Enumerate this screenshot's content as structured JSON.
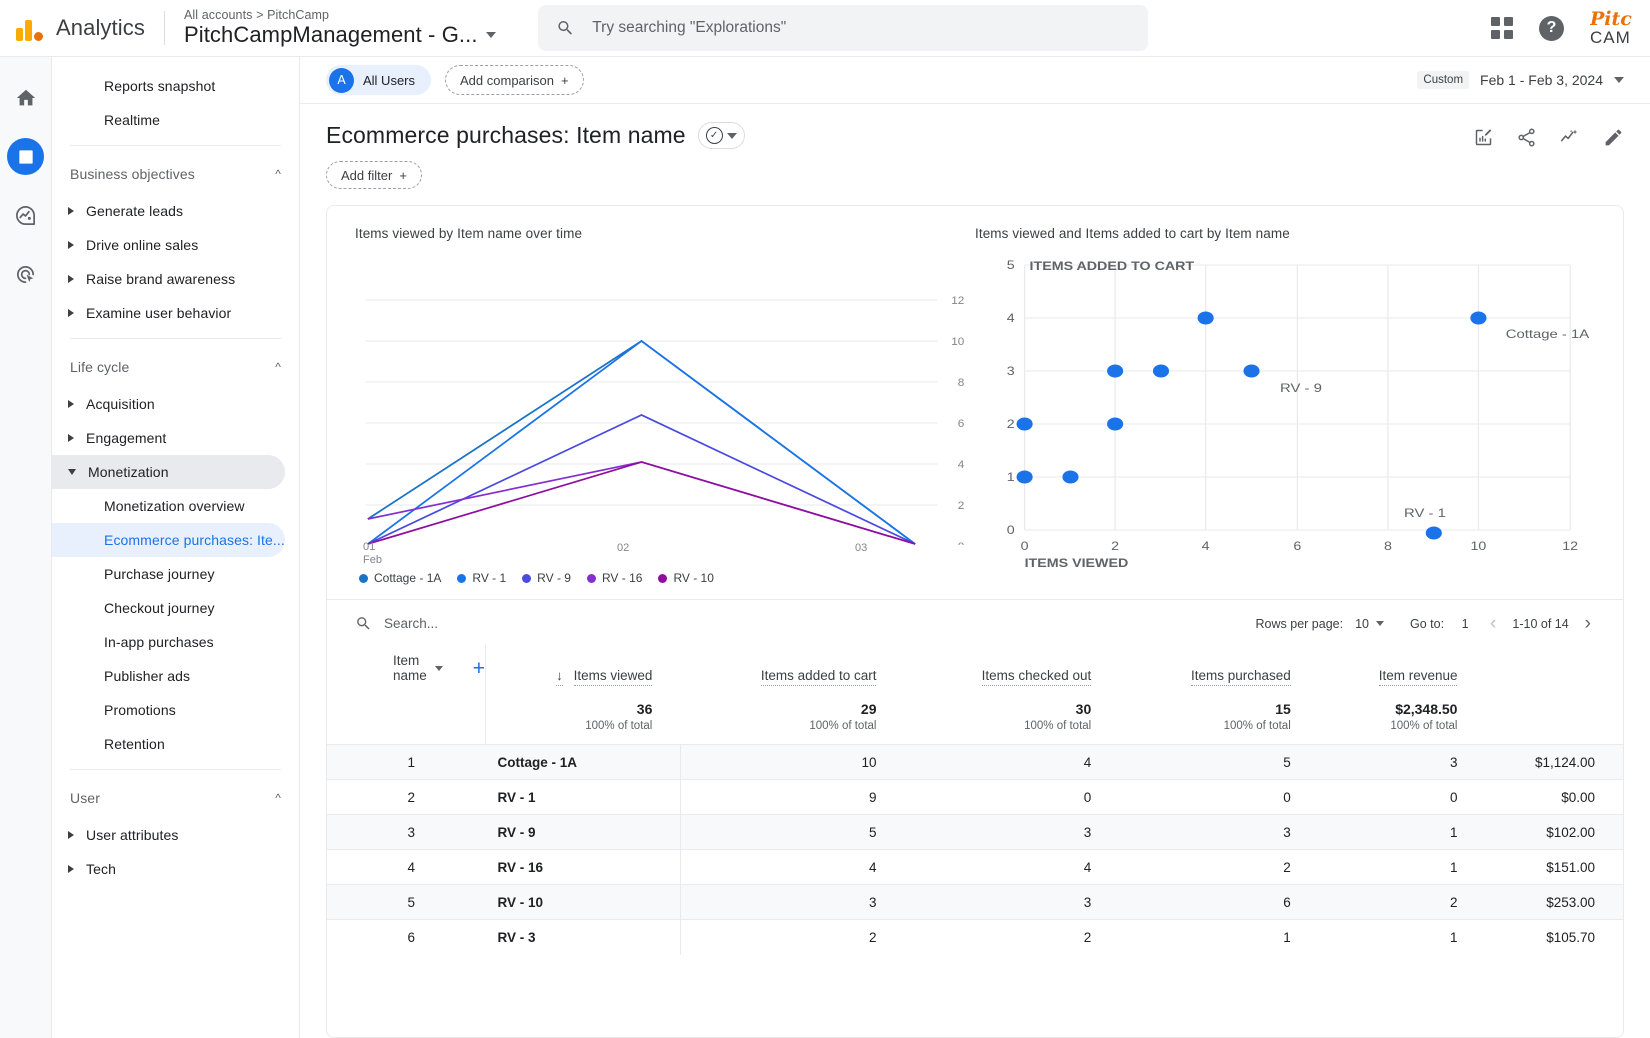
{
  "topbar": {
    "brand": "Analytics",
    "breadcrumb": "All accounts > PitchCamp",
    "property": "PitchCampManagement - G...",
    "search_placeholder": "Try searching \"Explorations\"",
    "avatar_line1": "Pitc",
    "avatar_line2": "CAM"
  },
  "rail": {
    "items": [
      {
        "name": "home-icon",
        "label": "Home"
      },
      {
        "name": "reports-icon",
        "label": "Reports"
      },
      {
        "name": "explore-icon",
        "label": "Explore"
      },
      {
        "name": "advertising-icon",
        "label": "Advertising"
      }
    ]
  },
  "sidebar": {
    "top_items": [
      {
        "label": "Reports snapshot"
      },
      {
        "label": "Realtime"
      }
    ],
    "sections": [
      {
        "label": "Business objectives",
        "items": [
          {
            "label": "Generate leads"
          },
          {
            "label": "Drive online sales"
          },
          {
            "label": "Raise brand awareness"
          },
          {
            "label": "Examine user behavior"
          }
        ]
      },
      {
        "label": "Life cycle",
        "items": [
          {
            "label": "Acquisition"
          },
          {
            "label": "Engagement"
          },
          {
            "label": "Monetization"
          },
          {
            "label": "Retention"
          }
        ],
        "monetization_children": [
          {
            "label": "Monetization overview"
          },
          {
            "label": "Ecommerce purchases: Ite..."
          },
          {
            "label": "Purchase journey"
          },
          {
            "label": "Checkout journey"
          },
          {
            "label": "In-app purchases"
          },
          {
            "label": "Publisher ads"
          },
          {
            "label": "Promotions"
          }
        ]
      },
      {
        "label": "User",
        "items": [
          {
            "label": "User attributes"
          },
          {
            "label": "Tech"
          }
        ]
      }
    ]
  },
  "controls": {
    "audience_initial": "A",
    "audience_label": "All Users",
    "add_comparison": "Add comparison",
    "date_tag": "Custom",
    "date_range": "Feb 1 - Feb 3, 2024"
  },
  "report": {
    "title": "Ecommerce purchases: Item name",
    "add_filter": "Add filter"
  },
  "table_controls": {
    "search_placeholder": "Search...",
    "rows_per_page_label": "Rows per page:",
    "rows_per_page_value": "10",
    "goto_label": "Go to:",
    "goto_value": "1",
    "range_label": "1-10 of 14"
  },
  "table": {
    "dimension_header": "Item name",
    "metric_headers": [
      "Items viewed",
      "Items added to cart",
      "Items checked out",
      "Items purchased",
      "Item revenue"
    ],
    "totals": [
      "36",
      "29",
      "30",
      "15",
      "$2,348.50"
    ],
    "totals_sub": [
      "100% of total",
      "100% of total",
      "100% of total",
      "100% of total",
      "100% of total"
    ],
    "rows": [
      {
        "idx": "1",
        "name": "Cottage - 1A",
        "values": [
          "10",
          "4",
          "5",
          "3",
          "$1,124.00"
        ]
      },
      {
        "idx": "2",
        "name": "RV - 1",
        "values": [
          "9",
          "0",
          "0",
          "0",
          "$0.00"
        ]
      },
      {
        "idx": "3",
        "name": "RV - 9",
        "values": [
          "5",
          "3",
          "3",
          "1",
          "$102.00"
        ]
      },
      {
        "idx": "4",
        "name": "RV - 16",
        "values": [
          "4",
          "4",
          "2",
          "1",
          "$151.00"
        ]
      },
      {
        "idx": "5",
        "name": "RV - 10",
        "values": [
          "3",
          "3",
          "6",
          "2",
          "$253.00"
        ]
      },
      {
        "idx": "6",
        "name": "RV - 3",
        "values": [
          "2",
          "2",
          "1",
          "1",
          "$105.70"
        ]
      }
    ]
  },
  "chart_data": [
    {
      "type": "line",
      "title": "Items viewed by Item name over time",
      "xlabel": "",
      "ylabel": "",
      "x": [
        "01",
        "02",
        "03"
      ],
      "x_sublabel": "Feb",
      "ylim": [
        0,
        12
      ],
      "yticks": [
        0,
        2,
        4,
        6,
        8,
        10,
        12
      ],
      "grid": true,
      "legend_position": "bottom",
      "series": [
        {
          "name": "Cottage - 1A",
          "color": "#1a73c8",
          "values": [
            1.3,
            10.0,
            0.1
          ]
        },
        {
          "name": "RV - 1",
          "color": "#1a73e8",
          "values": [
            0.1,
            10.0,
            0.1
          ]
        },
        {
          "name": "RV - 9",
          "color": "#4a4ae0",
          "values": [
            0.1,
            6.4,
            0.1
          ]
        },
        {
          "name": "RV - 16",
          "color": "#8430ce",
          "values": [
            1.3,
            4.1,
            0.1
          ]
        },
        {
          "name": "RV - 10",
          "color": "#8e0e9e",
          "values": [
            0.1,
            4.1,
            0.1
          ]
        }
      ]
    },
    {
      "type": "scatter",
      "title": "Items viewed and Items added to cart by Item name",
      "xlabel": "ITEMS VIEWED",
      "ylabel": "ITEMS ADDED TO CART",
      "xlim": [
        0,
        12
      ],
      "ylim": [
        0,
        5
      ],
      "xticks": [
        0,
        2,
        4,
        6,
        8,
        10,
        12
      ],
      "yticks": [
        0,
        1,
        2,
        3,
        4,
        5
      ],
      "grid": true,
      "color": "#1a73e8",
      "points": [
        {
          "x": 0,
          "y": 2,
          "label": ""
        },
        {
          "x": 0,
          "y": 1,
          "label": ""
        },
        {
          "x": 1,
          "y": 1,
          "label": ""
        },
        {
          "x": 2,
          "y": 3,
          "label": ""
        },
        {
          "x": 2,
          "y": 2,
          "label": ""
        },
        {
          "x": 3,
          "y": 3,
          "label": ""
        },
        {
          "x": 4,
          "y": 4,
          "label": ""
        },
        {
          "x": 5,
          "y": 3,
          "label": "RV - 9"
        },
        {
          "x": 9,
          "y": 0,
          "label": "RV - 1"
        },
        {
          "x": 10,
          "y": 4,
          "label": "Cottage - 1A"
        }
      ]
    }
  ]
}
